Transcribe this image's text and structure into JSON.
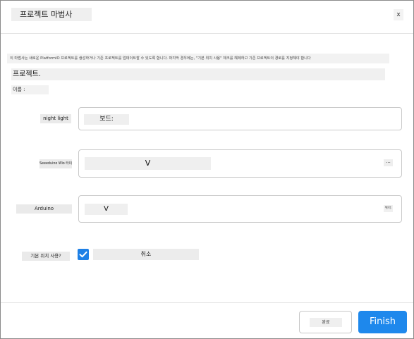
{
  "dialog": {
    "title": "프로젝트 마법사",
    "close_label": "x"
  },
  "description": "이 마법사는 새로운 PlatformIO 프로젝트를 생성하거나 기존 프로젝트를 업데이트할 수 있도록 합니다. 마지막 경우에는, \"기본 위치 사용\" 체크를 해제하고 기존 프로젝트의 경로를 지정해야 합니다",
  "section_title": "프로젝트.",
  "name_label": "이름 :",
  "fields": {
    "name": {
      "label": "night light",
      "value": "보드:"
    },
    "board": {
      "label": "Seeeduino Wio 터미널",
      "value": "V",
      "more_label": "..."
    },
    "framework": {
      "label": "Arduino",
      "value": "V",
      "side_note": "위치:"
    }
  },
  "use_default_location": {
    "label": "기본 위치 사용?",
    "checked": true,
    "text": "취소"
  },
  "footer": {
    "secondary_label": "완료",
    "primary_label": "Finish"
  },
  "colors": {
    "accent": "#1e88ec",
    "checkbox": "#1e80e6"
  }
}
